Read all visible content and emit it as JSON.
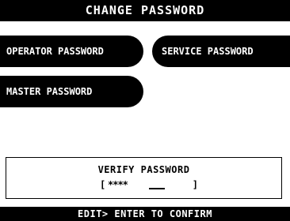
{
  "screen": {
    "title": "CHANGE PASSWORD"
  },
  "menu": {
    "operator_label": "OPERATOR PASSWORD",
    "service_label": "SERVICE PASSWORD",
    "master_label": "MASTER PASSWORD"
  },
  "verify": {
    "label": "VERIFY PASSWORD",
    "bracket_open": "[",
    "bracket_close": "]",
    "masked_value": "****"
  },
  "status": {
    "text": "EDIT> ENTER TO CONFIRM"
  },
  "colors": {
    "background": "#ffffff",
    "foreground": "#000000"
  }
}
